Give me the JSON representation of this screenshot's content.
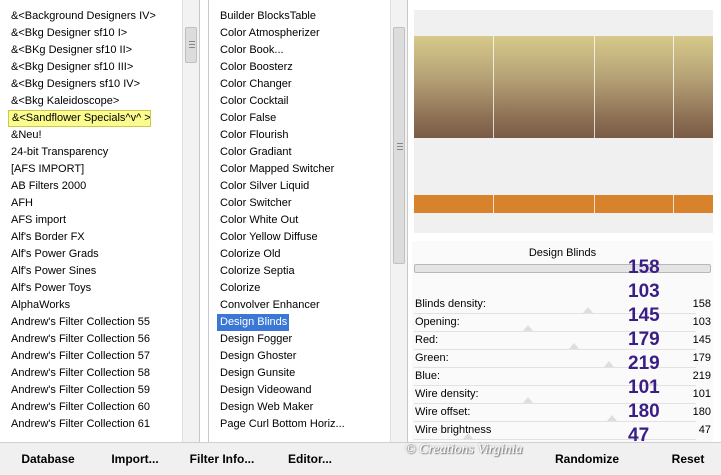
{
  "categories": [
    "&<Background Designers IV>",
    "&<Bkg Designer sf10 I>",
    "&<BKg Designer sf10 II>",
    "&<Bkg Designer sf10 III>",
    "&<Bkg Designers sf10 IV>",
    "&<Bkg Kaleidoscope>",
    "&<Sandflower Specials^v^ >",
    "&Neu!",
    "24-bit Transparency",
    "[AFS IMPORT]",
    "AB Filters 2000",
    "AFH",
    "AFS import",
    "Alf's Border FX",
    "Alf's Power Grads",
    "Alf's Power Sines",
    "Alf's Power Toys",
    "AlphaWorks",
    "Andrew's Filter Collection 55",
    "Andrew's Filter Collection 56",
    "Andrew's Filter Collection 57",
    "Andrew's Filter Collection 58",
    "Andrew's Filter Collection 59",
    "Andrew's Filter Collection 60",
    "Andrew's Filter Collection 61"
  ],
  "filters": [
    "Builder BlocksTable",
    "Color Atmospherizer",
    "Color Book...",
    "Color Boosterz",
    "Color Changer",
    "Color Cocktail",
    "Color False",
    "Color Flourish",
    "Color Gradiant",
    "Color Mapped Switcher",
    "Color Silver Liquid",
    "Color Switcher",
    "Color White Out",
    "Color Yellow Diffuse",
    "Colorize Old",
    "Colorize Septia",
    "Colorize",
    "Convolver Enhancer",
    "Design Blinds",
    "Design Fogger",
    "Design Ghoster",
    "Design Gunsite",
    "Design Videowand",
    "Design Web Maker",
    "Page Curl Bottom Horiz..."
  ],
  "selected_category": "&<Sandflower Specials^v^ >",
  "selected_filter": "Design Blinds",
  "preview": {
    "gradient_top": "#d6c98a",
    "gradient_bottom": "#7a5b46",
    "wire_color": "#d8822b"
  },
  "settings": {
    "title": "Design Blinds",
    "params": [
      {
        "label": "Blinds density:",
        "value": "158",
        "level": 0.62
      },
      {
        "label": "Opening:",
        "value": "103",
        "level": 0.4
      },
      {
        "label": "Red:",
        "value": "145",
        "level": 0.57
      },
      {
        "label": "Green:",
        "value": "179",
        "level": 0.7
      },
      {
        "label": "Blue:",
        "value": "219",
        "level": 0.86
      },
      {
        "label": "Wire density:",
        "value": "101",
        "level": 0.4
      },
      {
        "label": "Wire offset:",
        "value": "180",
        "level": 0.71
      },
      {
        "label": "Wire brightness",
        "value": "47",
        "level": 0.18
      }
    ]
  },
  "overlay_numbers": [
    "158",
    "103",
    "145",
    "179",
    "219",
    "101",
    "180",
    "47"
  ],
  "buttons": {
    "database": "Database",
    "import": "Import...",
    "filter_info": "Filter Info...",
    "editor": "Editor...",
    "randomize": "Randomize",
    "reset": "Reset"
  },
  "watermark": "© Creations Virginia"
}
